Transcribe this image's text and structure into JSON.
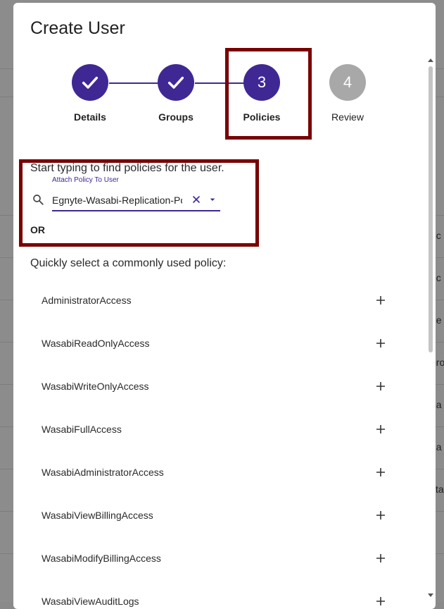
{
  "dialog": {
    "title": "Create User"
  },
  "stepper": {
    "steps": [
      {
        "label": "Details",
        "state": "done"
      },
      {
        "label": "Groups",
        "state": "done"
      },
      {
        "label": "Policies",
        "number": "3",
        "state": "active"
      },
      {
        "label": "Review",
        "number": "4",
        "state": "pending"
      }
    ]
  },
  "policy_search": {
    "hint": "Start typing to find policies for the user.",
    "field_label": "Attach Policy To User",
    "value": "Egnyte-Wasabi-Replication-Policy",
    "or_text": "OR"
  },
  "quick_select": {
    "label": "Quickly select a commonly used policy:",
    "policies": [
      "AdministratorAccess",
      "WasabiReadOnlyAccess",
      "WasabiWriteOnlyAccess",
      "WasabiFullAccess",
      "WasabiAdministratorAccess",
      "WasabiViewBillingAccess",
      "WasabiModifyBillingAccess",
      "WasabiViewAuditLogs"
    ]
  },
  "background": {
    "fragments": [
      "nc",
      "nc",
      "de",
      "pro",
      "qa",
      "qa",
      "sta"
    ]
  },
  "colors": {
    "accent": "#3f2894",
    "pending": "#a8a8a8",
    "highlight": "#7a0000"
  }
}
